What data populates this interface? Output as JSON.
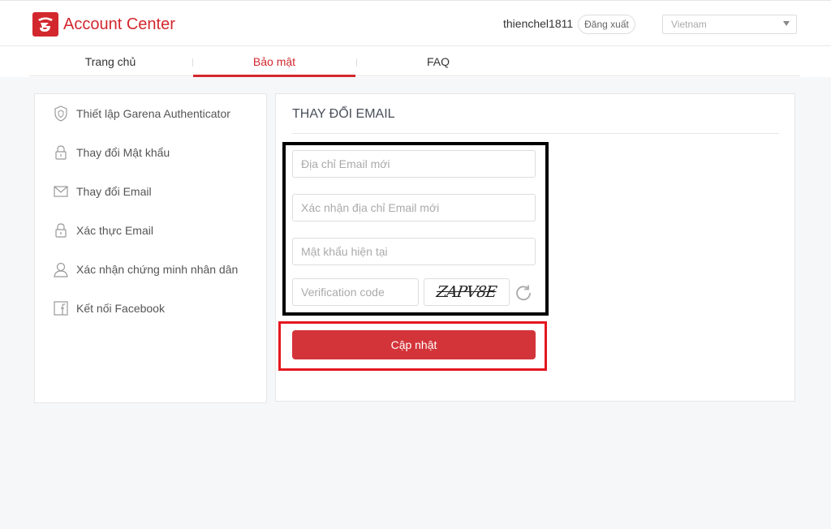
{
  "header": {
    "brand": "Account Center",
    "username": "thienchel1811",
    "logout_label": "Đăng xuất",
    "language": "Vietnam",
    "brand_color": "#d3272e"
  },
  "nav": {
    "tabs": [
      {
        "label": "Trang chủ",
        "active": false
      },
      {
        "label": "Bảo mật",
        "active": true
      },
      {
        "label": "FAQ",
        "active": false
      }
    ]
  },
  "sidebar": {
    "items": [
      {
        "label": "Thiết lập Garena Authenticator",
        "icon": "shield-icon"
      },
      {
        "label": "Thay đổi Mật khẩu",
        "icon": "lock-icon"
      },
      {
        "label": "Thay đổi Email",
        "icon": "envelope-icon"
      },
      {
        "label": "Xác thực Email",
        "icon": "lock-icon"
      },
      {
        "label": "Xác nhận chứng minh nhân dân",
        "icon": "person-icon"
      },
      {
        "label": "Kết nối Facebook",
        "icon": "facebook-icon"
      }
    ]
  },
  "main": {
    "title": "THAY ĐỔI EMAIL",
    "new_email_placeholder": "Địa chỉ Email mới",
    "confirm_email_placeholder": "Xác nhận địa chỉ Email mới",
    "password_placeholder": "Mật khẩu hiện tại",
    "code_placeholder": "Verification code",
    "captcha_text": "ZAPV8E",
    "submit_label": "Cập nhật",
    "submit_color": "#d3343a"
  }
}
